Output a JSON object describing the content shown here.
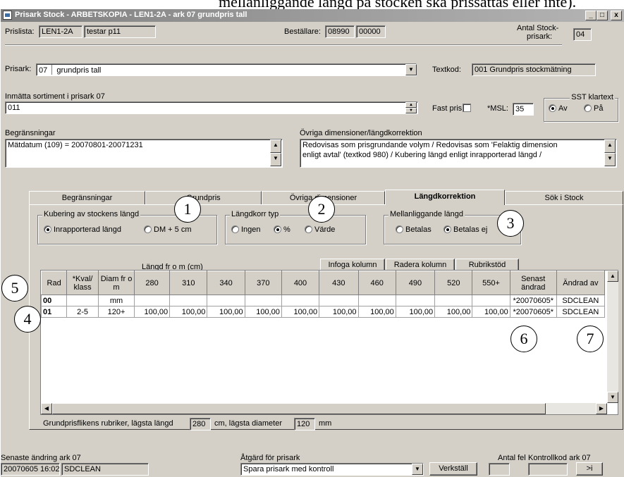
{
  "doc_header_text": "mellanliggande längd på stocken ska prissättas eller inte).",
  "window": {
    "title": "Prisark Stock - ARBETSKOPIA - LEN1-2A - ark 07 grundpris tall",
    "min": "_",
    "max": "□",
    "close": "x"
  },
  "top": {
    "prislista_label": "Prislista:",
    "prislista_code": "LEN1-2A",
    "prislista_name": "testar p11",
    "bestallare_label": "Beställare:",
    "bestallare_1": "08990",
    "bestallare_2": "00000",
    "antal_label_1": "Antal Stock-",
    "antal_label_2": "prisark:",
    "antal_value": "04"
  },
  "prisark": {
    "label": "Prisark:",
    "code": "07",
    "name": "grundpris tall",
    "textkod_label": "Textkod:",
    "textkod_value": "001 Grundpris stockmätning"
  },
  "sortiment": {
    "label": "Inmätta sortiment i prisark 07",
    "value": "011",
    "fast_pris_label": "Fast pris:",
    "msl_label": "*MSL:",
    "msl_value": "35",
    "sst_title": "SST klartext",
    "sst_av": "Av",
    "sst_pa": "På"
  },
  "begransningar": {
    "label": "Begränsningar",
    "value": "Mätdatum (109) = 20070801-20071231"
  },
  "ovriga": {
    "label": "Övriga dimensioner/längdkorrektion",
    "line1": "Redovisas som prisgrundande volym  /  Redovisas som 'Felaktig dimension",
    "line2": "enligt avtal' (textkod 980)  /  Kubering längd enligt inrapporterad längd  /"
  },
  "tabs": [
    "Begränsningar",
    "Grundpris",
    "Övriga dimensioner",
    "Längdkorrektion",
    "Sök i Stock"
  ],
  "kubering": {
    "title": "Kubering av stockens längd",
    "opt1": "Inrapporterad längd",
    "opt2": "DM + 5 cm"
  },
  "langdkorr": {
    "title": "Längdkorr typ",
    "opt1": "Ingen",
    "opt2": "%",
    "opt3": "Värde"
  },
  "mellan": {
    "title": "Mellanliggande längd",
    "opt1": "Betalas",
    "opt2": "Betalas ej"
  },
  "grid_toolbar": {
    "langd_label": "Längd fr o m (cm)",
    "infoga": "Infoga kolumn",
    "radera": "Radera kolumn",
    "rubrikstod": "Rubrikstöd"
  },
  "table": {
    "headers": [
      "Rad",
      "*Kval/ klass",
      "Diam fr o m",
      "280",
      "310",
      "340",
      "370",
      "400",
      "430",
      "460",
      "490",
      "520",
      "550+",
      "Senast ändrad",
      "Ändrad av"
    ],
    "rows": [
      [
        "00",
        "",
        "mm",
        "",
        "",
        "",
        "",
        "",
        "",
        "",
        "",
        "",
        "",
        "*20070605*",
        "SDCLEAN"
      ],
      [
        "01",
        "2-5",
        "120+",
        "100,00",
        "100,00",
        "100,00",
        "100,00",
        "100,00",
        "100,00",
        "100,00",
        "100,00",
        "100,00",
        "100,00",
        "*20070605*",
        "SDCLEAN"
      ]
    ]
  },
  "grundpris_info": {
    "text1": "Grundprisflikens rubriker, lägsta längd",
    "len": "280",
    "text2": "cm, lägsta diameter",
    "diam": "120",
    "unit": "mm"
  },
  "bottom": {
    "senaste_label": "Senaste ändring ark 07",
    "senaste_date": "20070605 16:02",
    "senaste_user": "SDCLEAN",
    "atgard_label": "Åtgärd för prisark",
    "atgard_value": "Spara prisark med kontroll",
    "verkstall": "Verkställ",
    "antal_fel_label": "Antal fel",
    "kontrollkod_label": "Kontrollkod ark 07",
    "goto": ">i"
  },
  "callouts": [
    "1",
    "2",
    "3",
    "4",
    "5",
    "6",
    "7"
  ]
}
